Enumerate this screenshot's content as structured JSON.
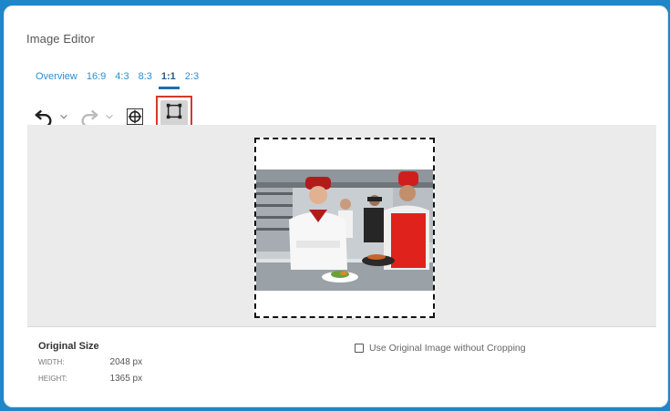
{
  "window": {
    "title": "Image Editor"
  },
  "tabs": [
    {
      "label": "Overview",
      "active": false
    },
    {
      "label": "16:9",
      "active": false
    },
    {
      "label": "4:3",
      "active": false
    },
    {
      "label": "8:3",
      "active": false
    },
    {
      "label": "1:1",
      "active": true
    },
    {
      "label": "2:3",
      "active": false
    }
  ],
  "toolbar": {
    "undo_icon": "undo-icon",
    "redo_icon": "redo-icon",
    "focus_icon": "crosshair-icon",
    "crop_icon": "crop-frame-icon"
  },
  "info": {
    "heading": "Original Size",
    "width_label": "WIDTH:",
    "width_value": "2048 px",
    "height_label": "HEIGHT:",
    "height_value": "1365 px"
  },
  "options": {
    "use_original_label": "Use Original Image without Cropping",
    "use_original_checked": false
  },
  "colors": {
    "accent": "#1d6fae",
    "highlight_border": "#d9372b",
    "background_frame": "#1f86c9"
  }
}
